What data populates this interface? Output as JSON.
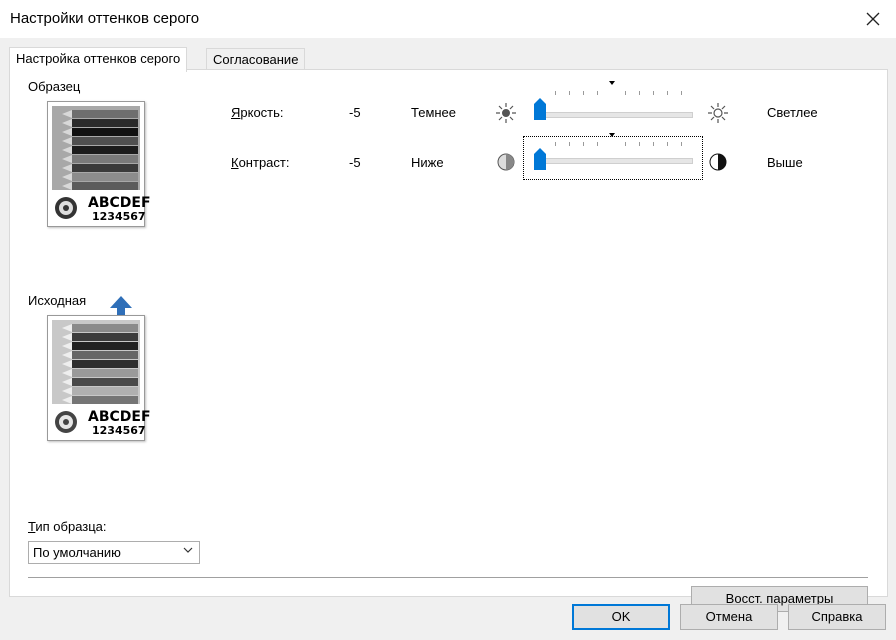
{
  "window": {
    "title": "Настройки оттенков серого"
  },
  "tabs": [
    {
      "label": "Настройка оттенков серого",
      "active": true
    },
    {
      "label": "Согласование",
      "active": false
    }
  ],
  "preview": {
    "sample_label": "Образец",
    "original_label": "Исходная",
    "image_text_line1": "ABCDEF",
    "image_text_line2": "1234567"
  },
  "brightness": {
    "label_accel": "Я",
    "label_rest": "ркость:",
    "value": "-5",
    "low_label": "Темнее",
    "high_label": "Светлее",
    "low_icon": "sun-dim-icon",
    "high_icon": "sun-bright-icon"
  },
  "contrast": {
    "label_accel": "К",
    "label_rest": "онтраст:",
    "value": "-5",
    "low_label": "Ниже",
    "high_label": "Выше",
    "low_icon": "contrast-low-icon",
    "high_icon": "contrast-high-icon"
  },
  "sample_type": {
    "label_accel": "Т",
    "label_rest": "ип образца:",
    "selected": "По умолчанию"
  },
  "buttons": {
    "reset_accel": "В",
    "reset_rest": "осст. параметры",
    "ok": "OK",
    "cancel": "Отмена",
    "help": "Справка"
  },
  "colors": {
    "accent": "#0078d7",
    "arrow": "#2f6fb8"
  }
}
